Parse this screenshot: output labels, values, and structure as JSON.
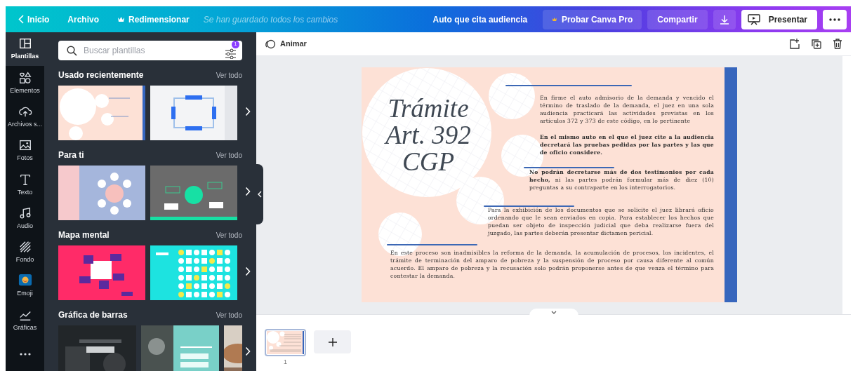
{
  "topbar": {
    "back_label": "Inicio",
    "menu": [
      "Archivo"
    ],
    "resize_label": "Redimensionar",
    "save_status": "Se han guardado todos los cambios",
    "doc_title": "Auto que cita audiencia",
    "buttons": [
      {
        "kind": "pro",
        "label": "Probar Canva Pro"
      },
      {
        "kind": "share",
        "label": "Compartir"
      },
      {
        "kind": "download"
      },
      {
        "kind": "present",
        "label": "Presentar"
      },
      {
        "kind": "more"
      }
    ]
  },
  "sidebar": {
    "items": [
      {
        "kind": "templates",
        "label": "Plantillas",
        "selected": true
      },
      {
        "kind": "elements",
        "label": "Elementos",
        "selected": false
      },
      {
        "kind": "uploads",
        "label": "Archivos s...",
        "selected": false
      },
      {
        "kind": "photos",
        "label": "Fotos",
        "selected": false
      },
      {
        "kind": "text",
        "label": "Texto",
        "selected": false
      },
      {
        "kind": "audio",
        "label": "Audio",
        "selected": false
      },
      {
        "kind": "background",
        "label": "Fondo",
        "selected": false
      },
      {
        "kind": "emoji",
        "label": "Emoji",
        "selected": false
      },
      {
        "kind": "charts",
        "label": "Gráficas",
        "selected": false
      },
      {
        "kind": "more",
        "selected": false
      }
    ]
  },
  "panel": {
    "search": {
      "placeholder": "Buscar plantillas"
    },
    "filter_badge": "1",
    "sections": [
      {
        "title": "Usado recientemente",
        "link": "Ver todo"
      },
      {
        "title": "Para ti",
        "link": "Ver todo"
      },
      {
        "title": "Mapa mental",
        "link": "Ver todo"
      },
      {
        "title": "Gráfica de barras",
        "link": "Ver todo"
      }
    ]
  },
  "toolbar": {
    "animate_label": "Animar"
  },
  "design": {
    "title_lines": [
      "Trámite",
      "Art. 392",
      "CGP"
    ],
    "paragraphs": [
      "En firme el auto admisorio de la demanda y vencido el término de traslado de la demanda, el juez en una sola audiencia practicará las actividades previstas en los artículos 372 y 373 de este código, en lo pertinente",
      "**En el mismo auto en el que el juez cite a la audiencia decretará las pruebas pedidas por las partes y las que de oficio considere.**",
      "**No podrán decretarse más de dos testimonios por cada hecho,** ni las partes podrán formular más de diez (10) preguntas a su contraparte en los interrogatorios.",
      "Para la exhibición de los documentos que se solicite el juez librará oficio ordenando que le sean enviados en copia. Para establecer los hechos que puedan ser objeto de inspección judicial que deba realizarse fuera del juzgado, las partes deberán presentar dictamen pericial.",
      "En este proceso son inadmisibles la reforma de la demanda, la acumulación de procesos, los incidentes, el trámite de terminación del amparo de pobreza y la suspensión de proceso por causa diferente al común acuerdo. El amparo de pobreza y la recusación solo podrán proponerse antes de que venza el término para contestar la demanda."
    ]
  },
  "pages": [
    {
      "number": "1",
      "selected": true
    }
  ]
}
